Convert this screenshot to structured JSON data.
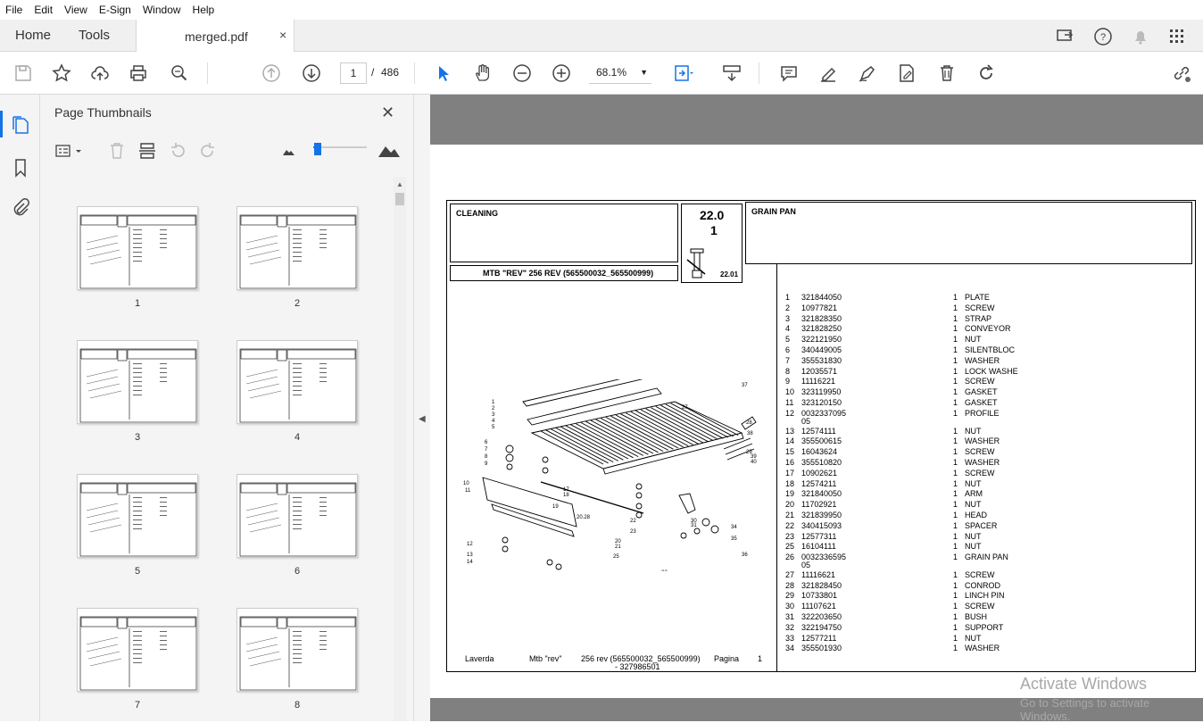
{
  "menubar": {
    "items": [
      "File",
      "Edit",
      "View",
      "E-Sign",
      "Window",
      "Help"
    ]
  },
  "tabs": {
    "home": "Home",
    "tools": "Tools",
    "document": "merged.pdf",
    "close": "×"
  },
  "toolbar": {
    "current_page": "1",
    "separator": "/",
    "total_pages": "486",
    "zoom": "68.1%"
  },
  "panel": {
    "title": "Page Thumbnails",
    "close": "✕",
    "thumbnail_labels": [
      "1",
      "2",
      "3",
      "4",
      "5",
      "6",
      "7",
      "8"
    ]
  },
  "pdf": {
    "section": "CLEANING",
    "code_major": "22.0",
    "code_minor": "1",
    "code_sub": "22.01",
    "group_title": "GRAIN PAN",
    "model": "MTB \"REV\" 256 REV (565500032_565500999)",
    "parts": [
      {
        "n": "1",
        "code": "321844050",
        "qty": "1",
        "desc": "PLATE"
      },
      {
        "n": "2",
        "code": "10977821",
        "qty": "1",
        "desc": "SCREW"
      },
      {
        "n": "3",
        "code": "321828350",
        "qty": "1",
        "desc": "STRAP"
      },
      {
        "n": "4",
        "code": "321828250",
        "qty": "1",
        "desc": "CONVEYOR"
      },
      {
        "n": "5",
        "code": "322121950",
        "qty": "1",
        "desc": "NUT"
      },
      {
        "n": "6",
        "code": "340449005",
        "qty": "1",
        "desc": "SILENTBLOC"
      },
      {
        "n": "7",
        "code": "355531830",
        "qty": "1",
        "desc": "WASHER"
      },
      {
        "n": "8",
        "code": "12035571",
        "qty": "1",
        "desc": "LOCK WASHE"
      },
      {
        "n": "9",
        "code": "11116221",
        "qty": "1",
        "desc": "SCREW"
      },
      {
        "n": "10",
        "code": "323119950",
        "qty": "1",
        "desc": "GASKET"
      },
      {
        "n": "11",
        "code": "323120150",
        "qty": "1",
        "desc": "GASKET"
      },
      {
        "n": "12",
        "code": "0032337095",
        "code2": "05",
        "qty": "1",
        "desc": "PROFILE"
      },
      {
        "n": "13",
        "code": "12574111",
        "qty": "1",
        "desc": "NUT"
      },
      {
        "n": "14",
        "code": "355500615",
        "qty": "1",
        "desc": "WASHER"
      },
      {
        "n": "15",
        "code": "16043624",
        "qty": "1",
        "desc": "SCREW"
      },
      {
        "n": "16",
        "code": "355510820",
        "qty": "1",
        "desc": "WASHER"
      },
      {
        "n": "17",
        "code": "10902621",
        "qty": "1",
        "desc": "SCREW"
      },
      {
        "n": "18",
        "code": "12574211",
        "qty": "1",
        "desc": "NUT"
      },
      {
        "n": "19",
        "code": "321840050",
        "qty": "1",
        "desc": "ARM"
      },
      {
        "n": "20",
        "code": "11702921",
        "qty": "1",
        "desc": "NUT"
      },
      {
        "n": "21",
        "code": "321839950",
        "qty": "1",
        "desc": "HEAD"
      },
      {
        "n": "22",
        "code": "340415093",
        "qty": "1",
        "desc": "SPACER"
      },
      {
        "n": "23",
        "code": "12577311",
        "qty": "1",
        "desc": "NUT"
      },
      {
        "n": "25",
        "code": "16104111",
        "qty": "1",
        "desc": "NUT"
      },
      {
        "n": "26",
        "code": "0032336595",
        "code2": "05",
        "qty": "1",
        "desc": "GRAIN PAN"
      },
      {
        "n": "27",
        "code": "11116621",
        "qty": "1",
        "desc": "SCREW"
      },
      {
        "n": "28",
        "code": "321828450",
        "qty": "1",
        "desc": "CONROD"
      },
      {
        "n": "29",
        "code": "10733801",
        "qty": "1",
        "desc": "LINCH PIN"
      },
      {
        "n": "30",
        "code": "11107621",
        "qty": "1",
        "desc": "SCREW"
      },
      {
        "n": "31",
        "code": "322203650",
        "qty": "1",
        "desc": "BUSH"
      },
      {
        "n": "32",
        "code": "322194750",
        "qty": "1",
        "desc": "SUPPORT"
      },
      {
        "n": "33",
        "code": "12577211",
        "qty": "1",
        "desc": "NUT"
      },
      {
        "n": "34",
        "code": "355501930",
        "qty": "1",
        "desc": "WASHER"
      }
    ],
    "footer": {
      "brand": "Laverda",
      "model": "Mtb \"rev\"",
      "rev": "256 rev (565500032_565500999)",
      "partno": "- 327986501",
      "page_label": "Pagina",
      "page_num": "1"
    },
    "diagram_labels": [
      "1",
      "2",
      "3",
      "4",
      "5",
      "6",
      "7",
      "8",
      "9",
      "10",
      "11",
      "12",
      "13",
      "14",
      "15",
      "16",
      "17",
      "18",
      "19",
      "20",
      "21",
      "22",
      "23",
      "25",
      "26",
      "27",
      "28",
      "29",
      "30",
      "31",
      "32",
      "33",
      "34",
      "35",
      "36",
      "37",
      "38",
      "39",
      "40"
    ],
    "diagram_ref": "20.28"
  },
  "watermark": {
    "line1": "Activate Windows",
    "line2": "Go to Settings to activate Windows."
  }
}
